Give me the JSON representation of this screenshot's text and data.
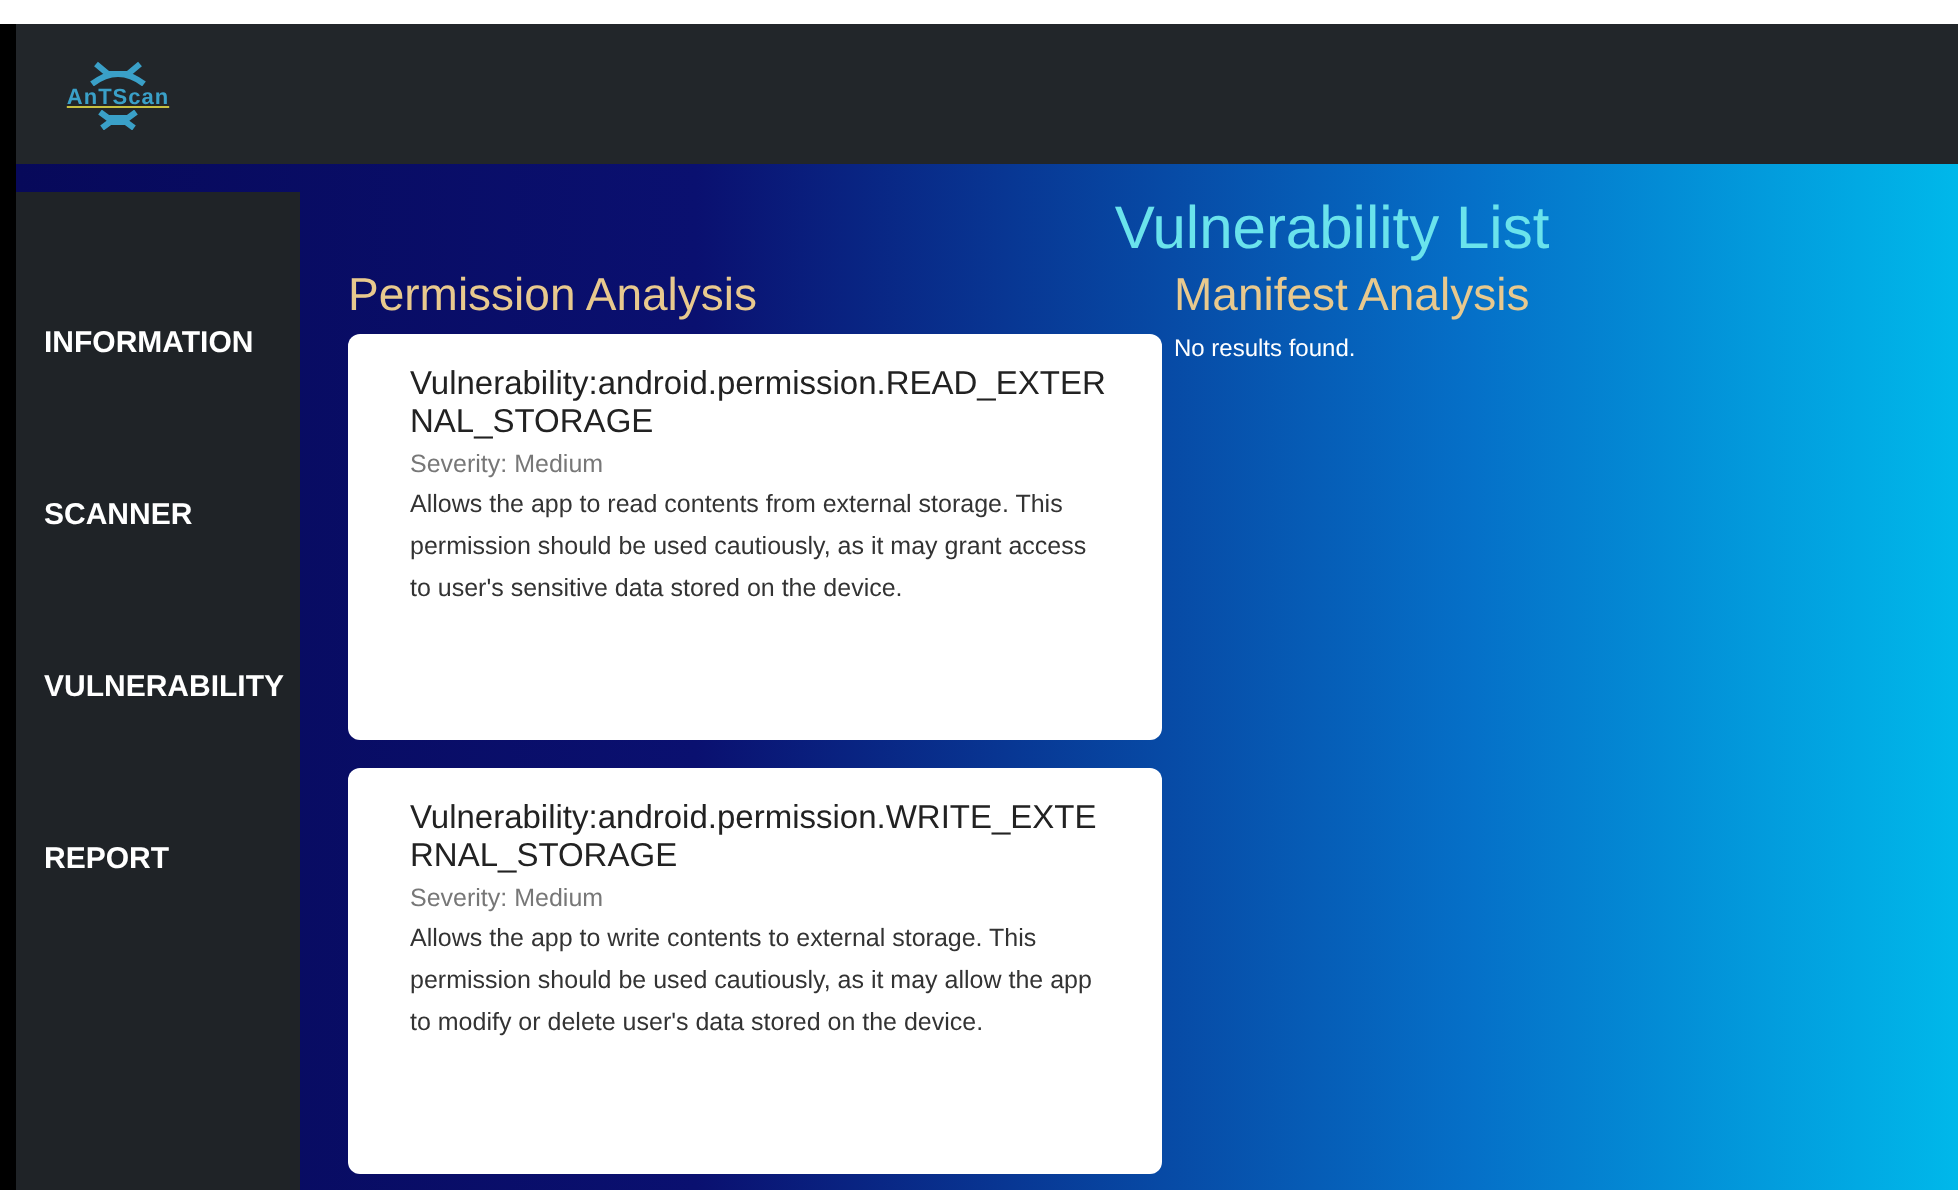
{
  "header": {
    "logo_text": "AnTScan"
  },
  "sidebar": {
    "items": [
      {
        "label": "INFORMATION",
        "selected": false
      },
      {
        "label": "SCANNER",
        "selected": false
      },
      {
        "label": "VULNERABILITY",
        "selected": false
      },
      {
        "label": "REPORT",
        "selected": false
      }
    ]
  },
  "title": "Vulnerability List",
  "permission_analysis": {
    "heading": "Permission Analysis",
    "items": [
      {
        "name": "Vulnerability:android.permission.READ_EXTERNAL_STORAGE",
        "severity": "Severity: Medium",
        "description": "Allows the app to read contents from external storage. This permission should be used cautiously, as it may grant access to user's sensitive data stored on the device."
      },
      {
        "name": "Vulnerability:android.permission.WRITE_EXTERNAL_STORAGE",
        "severity": "Severity: Medium",
        "description": "Allows the app to write contents to external storage. This permission should be used cautiously, as it may allow the app to modify or delete user's data stored on the device."
      }
    ]
  },
  "manifest_analysis": {
    "heading": "Manifest Analysis",
    "message": "No results found."
  }
}
